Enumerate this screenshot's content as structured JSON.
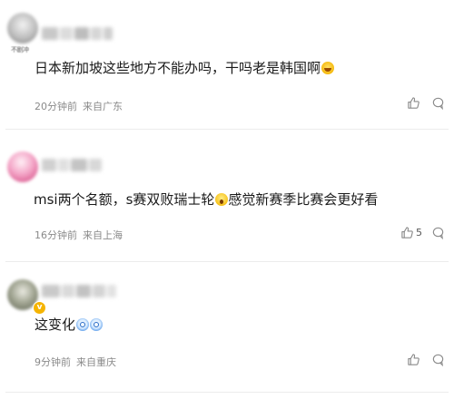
{
  "comments": [
    {
      "text": "日本新加坡这些地方不能办吗，干吗老是韩国啊",
      "time": "20分钟前",
      "location": "来自广东",
      "likes": "",
      "avatar_label": "不剧冲"
    },
    {
      "text_part1": "msi两个名额，s赛双败瑞士轮",
      "text_part2": "感觉新赛季比赛会更好看",
      "time": "16分钟前",
      "location": "来自上海",
      "likes": "5"
    },
    {
      "text": "这变化",
      "time": "9分钟前",
      "location": "来自重庆",
      "likes": "",
      "badge": "v"
    }
  ],
  "icons": {
    "like": "thumbs-up-icon",
    "reply": "comment-icon",
    "emoji_1": "laughing-emoji",
    "emoji_2": "shocked-emoji",
    "emoji_3": "dizzy-face-emoji"
  },
  "colors": {
    "text": "#1a1a1a",
    "meta": "#8a8a8a",
    "badge": "#f5b400",
    "divider": "#ececec"
  }
}
